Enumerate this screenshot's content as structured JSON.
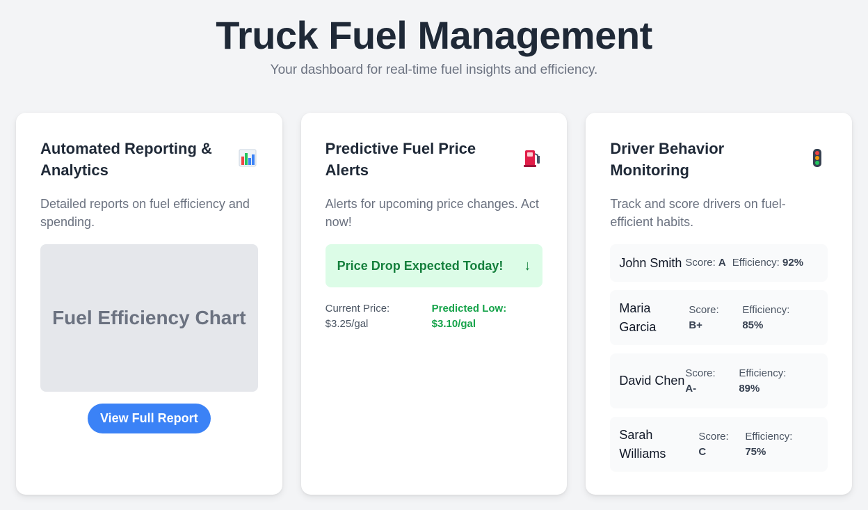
{
  "header": {
    "title": "Truck Fuel Management",
    "subtitle": "Your dashboard for real-time fuel insights and efficiency."
  },
  "reporting": {
    "title": "Automated Reporting & Analytics",
    "icon": "bar-chart-icon",
    "description": "Detailed reports on fuel efficiency and spending.",
    "chart_placeholder": "Fuel Efficiency Chart",
    "button_label": "View Full Report"
  },
  "alerts": {
    "title": "Predictive Fuel Price Alerts",
    "icon": "fuel-pump-icon",
    "description": "Alerts for upcoming price changes. Act now!",
    "alert_text": "Price Drop Expected Today!",
    "alert_arrow": "↓",
    "current_label": "Current Price:",
    "current_value": "$3.25/gal",
    "predicted_label": "Predicted Low:",
    "predicted_value": "$3.10/gal"
  },
  "drivers": {
    "title": "Driver Behavior Monitoring",
    "icon": "traffic-light-icon",
    "description": "Track and score drivers on fuel-efficient habits.",
    "score_label": "Score:",
    "efficiency_label": "Efficiency:",
    "list": [
      {
        "name": "John Smith",
        "score": "A",
        "efficiency": "92%"
      },
      {
        "name": "Maria Garcia",
        "score": "B+",
        "efficiency": "85%"
      },
      {
        "name": "David Chen",
        "score": "A-",
        "efficiency": "89%"
      },
      {
        "name": "Sarah Williams",
        "score": "C",
        "efficiency": "75%"
      }
    ]
  },
  "colors": {
    "accent": "#3b82f6",
    "success": "#16a34a",
    "success_bg": "#dcfce7"
  }
}
